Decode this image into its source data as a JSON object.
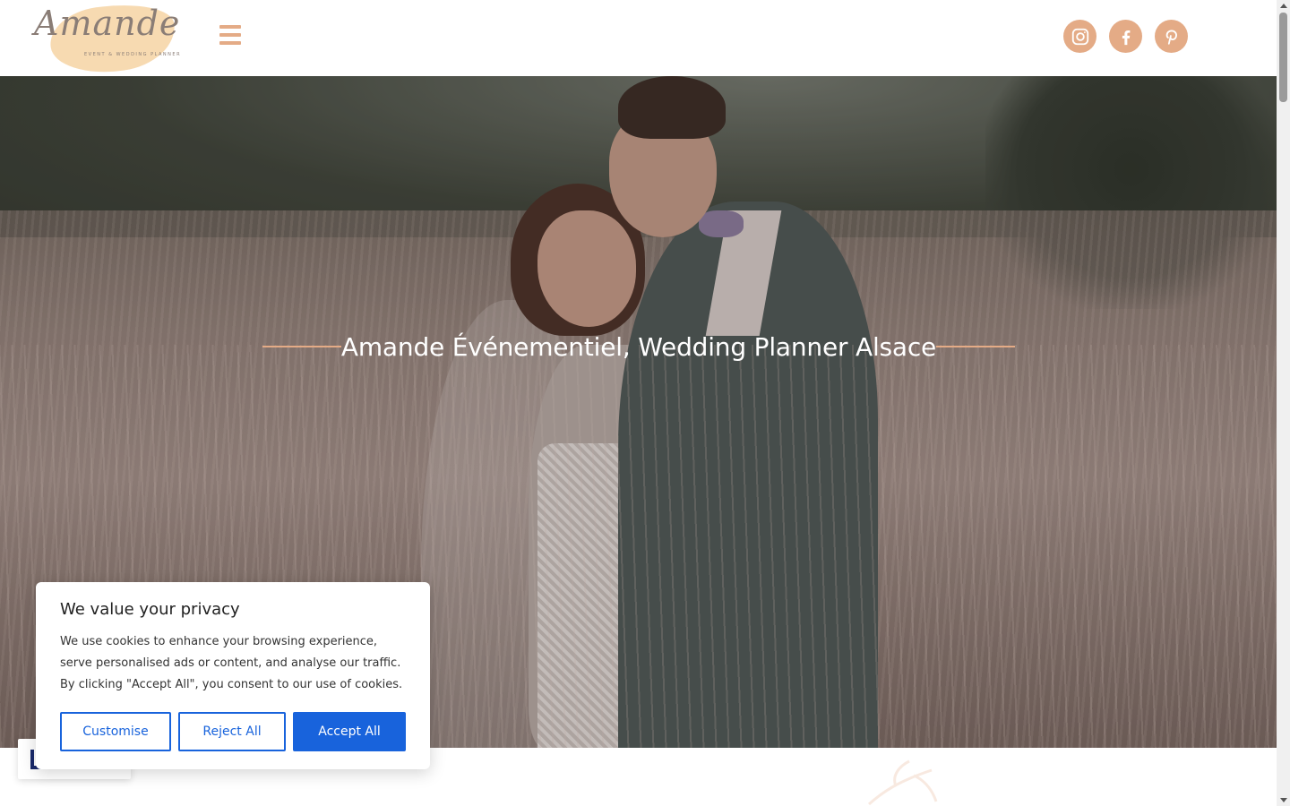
{
  "header": {
    "logo_text": "Amande",
    "logo_tagline": "EVENT & WEDDING PLANNER",
    "menu_icon": "hamburger-menu-icon",
    "social": [
      {
        "name": "instagram",
        "icon": "instagram-icon"
      },
      {
        "name": "facebook",
        "icon": "facebook-icon"
      },
      {
        "name": "pinterest",
        "icon": "pinterest-icon"
      }
    ]
  },
  "hero": {
    "title": "Amande Événementiel, Wedding Planner Alsace",
    "accent_color": "#e4ab86"
  },
  "cookie_banner": {
    "title": "We value your privacy",
    "text": "We use cookies to enhance your browsing experience, serve personalised ads or content, and analyse our traffic. By clicking \"Accept All\", you consent to our use of cookies.",
    "customise_label": "Customise",
    "reject_label": "Reject All",
    "accept_label": "Accept All",
    "button_color": "#1863dc"
  }
}
